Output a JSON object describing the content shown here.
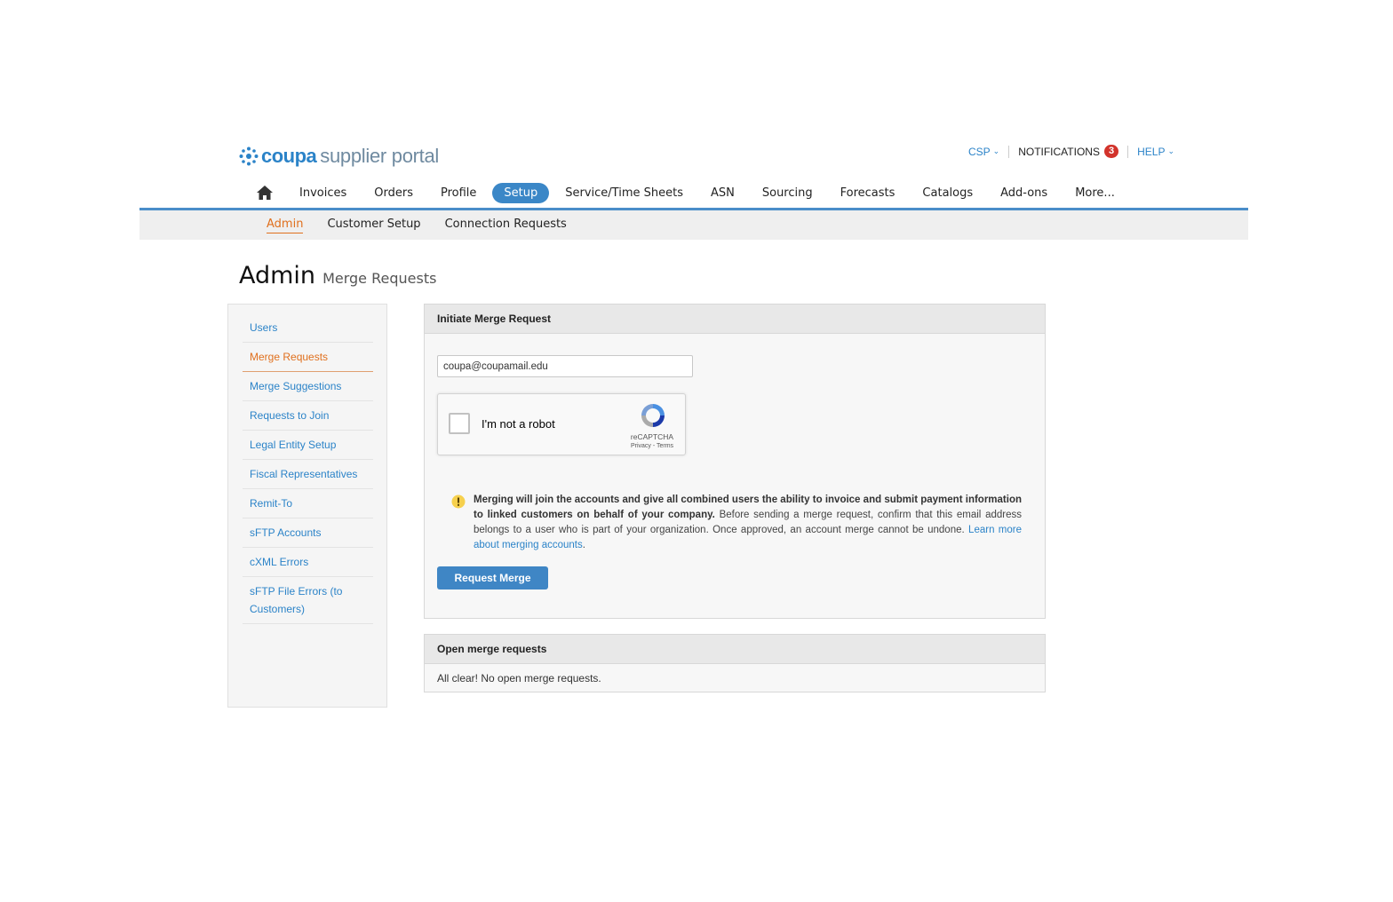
{
  "header": {
    "logo_brand": "coupa",
    "logo_rest": "supplier portal",
    "csp_label": "CSP",
    "notifications_label": "NOTIFICATIONS",
    "notifications_count": "3",
    "help_label": "HELP"
  },
  "nav": {
    "items": [
      "Invoices",
      "Orders",
      "Profile",
      "Setup",
      "Service/Time Sheets",
      "ASN",
      "Sourcing",
      "Forecasts",
      "Catalogs",
      "Add-ons",
      "More..."
    ],
    "active": "Setup"
  },
  "subnav": {
    "items": [
      "Admin",
      "Customer Setup",
      "Connection Requests"
    ],
    "active": "Admin"
  },
  "page": {
    "title": "Admin",
    "subtitle": "Merge Requests"
  },
  "sidebar": {
    "items": [
      {
        "label": "Users"
      },
      {
        "label": "Merge Requests"
      },
      {
        "label": "Merge Suggestions"
      },
      {
        "label": "Requests to Join"
      },
      {
        "label": "Legal Entity Setup"
      },
      {
        "label": "Fiscal Representatives"
      },
      {
        "label": "Remit-To"
      },
      {
        "label": "sFTP Accounts"
      },
      {
        "label": "cXML Errors"
      },
      {
        "label": "sFTP File Errors (to Customers)"
      }
    ],
    "active": "Merge Requests"
  },
  "initiate": {
    "heading": "Initiate Merge Request",
    "email_value": "coupa@coupamail.edu",
    "captcha_label": "I'm not a robot",
    "captcha_brand": "reCAPTCHA",
    "captcha_links": "Privacy - Terms",
    "warning_bold": "Merging will join the accounts and give all combined users the ability to invoice and submit payment information to linked customers on behalf of your company.",
    "warning_text": " Before sending a merge request, confirm that this email address belongs to a user who is part of your organization. Once approved, an account merge cannot be undone. ",
    "warning_link": "Learn more about merging accounts",
    "warning_end": ".",
    "button_label": "Request Merge"
  },
  "open_requests": {
    "heading": "Open merge requests",
    "message": "All clear! No open merge requests."
  },
  "colors": {
    "accent_blue": "#2b83c8",
    "active_orange": "#e0701e",
    "badge_red": "#d2332b"
  }
}
